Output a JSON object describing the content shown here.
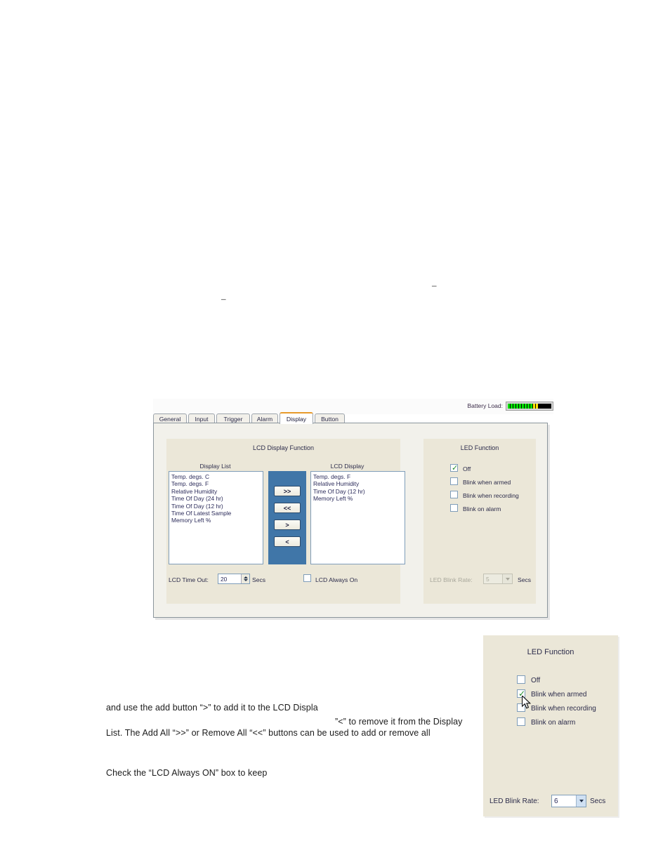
{
  "document": {
    "paragraphs": [
      {
        "id": "p1",
        "text": "and use the add button “>” to add it to the LCD Displa"
      },
      {
        "id": "p2",
        "text": "”<” to remove it from the Display"
      },
      {
        "id": "p3",
        "text": "List. The Add All “>>” or Remove All “<<” buttons can be used to add or remove all"
      },
      {
        "id": "p4",
        "text": "Check the “LCD Always ON” box to keep"
      }
    ],
    "dashes": [
      "–",
      "–"
    ]
  },
  "dialog": {
    "battery": {
      "label": "Battery Load:",
      "green_segments": 9,
      "yellow_segments": 2,
      "empty_segments": 6,
      "green_color": "#00e000",
      "yellow_color": "#ffe500",
      "empty_color": "#000000"
    },
    "tabs": [
      {
        "label": "General",
        "active": false
      },
      {
        "label": "Input",
        "active": false
      },
      {
        "label": "Trigger",
        "active": false
      },
      {
        "label": "Alarm",
        "active": false
      },
      {
        "label": "Display",
        "active": true
      },
      {
        "label": "Button",
        "active": false
      }
    ],
    "active_tab_accent": "#e79a2b",
    "lcd_panel": {
      "title": "LCD Display Function",
      "display_list_label": "Display List",
      "lcd_display_label": "LCD Display",
      "display_list_items": [
        "Temp. degs. C",
        "Temp. degs. F",
        "Relative Humidity",
        "Time Of Day (24 hr)",
        "Time Of Day (12 hr)",
        "Time Of Latest Sample",
        "Memory Left %"
      ],
      "lcd_display_items": [
        "Temp. degs. F",
        "Relative Humidity",
        "Time Of Day (12 hr)",
        "Memory Left %"
      ],
      "transfer_buttons": [
        {
          "label": ">>",
          "name": "add-all-button"
        },
        {
          "label": "<<",
          "name": "remove-all-button"
        },
        {
          "label": ">",
          "name": "add-button"
        },
        {
          "label": "<",
          "name": "remove-button"
        }
      ],
      "transfer_strip_color": "#4076a8",
      "timeout_label": "LCD Time Out:",
      "timeout_value": "20",
      "timeout_units": "Secs",
      "always_on_label": "LCD Always On",
      "always_on_checked": false
    },
    "led_panel": {
      "title": "LED Function",
      "options": [
        {
          "label": "Off",
          "checked": true
        },
        {
          "label": "Blink when armed",
          "checked": false
        },
        {
          "label": "Blink when recording",
          "checked": false
        },
        {
          "label": "Blink on alarm",
          "checked": false
        }
      ],
      "blink_rate_label": "LED Blink Rate:",
      "blink_rate_value": "5",
      "blink_rate_units": "Secs",
      "blink_rate_enabled": false
    }
  },
  "inset_led_panel": {
    "title": "LED Function",
    "options": [
      {
        "label": "Off",
        "checked": false
      },
      {
        "label": "Blink when armed",
        "checked": true
      },
      {
        "label": "Blink when recording",
        "checked": false
      },
      {
        "label": "Blink on alarm",
        "checked": false
      }
    ],
    "blink_rate_label": "LED Blink Rate:",
    "blink_rate_value": "6",
    "blink_rate_units": "Secs",
    "blink_rate_enabled": true,
    "cursor_visible": true
  }
}
